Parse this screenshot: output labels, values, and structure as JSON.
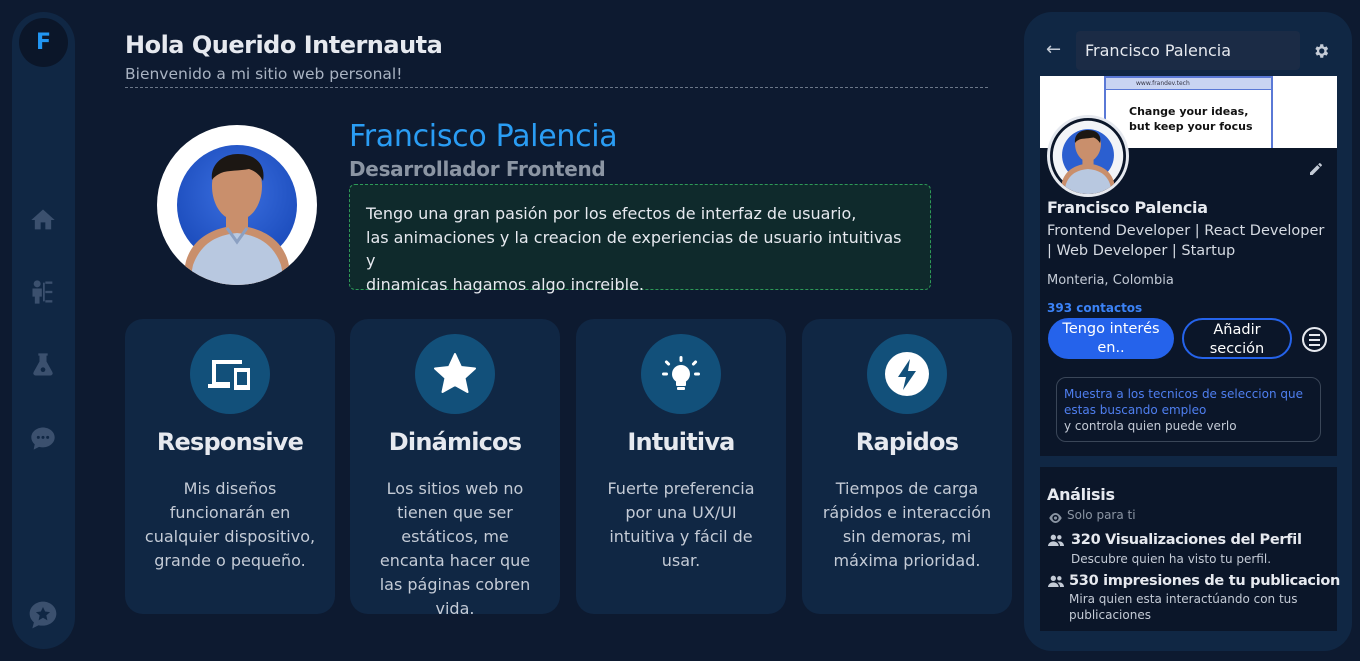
{
  "app": {
    "logo_letter": "F"
  },
  "nav": {
    "items": [
      {
        "icon": "home-icon"
      },
      {
        "icon": "skills-tree-icon"
      },
      {
        "icon": "lab-flask-icon"
      },
      {
        "icon": "chat-icon"
      },
      {
        "icon": "star-badge-icon"
      }
    ]
  },
  "header": {
    "title": "Hola Querido Internauta",
    "subtitle": "Bienvenido a mi sitio web personal!"
  },
  "profile": {
    "name": "Francisco Palencia",
    "role": "Desarrollador Frontend",
    "bio_lines": [
      "Tengo una gran pasión por los efectos de interfaz de usuario,",
      "las animaciones y la creacion de experiencias de usuario intuitivas y",
      "dinamicas hagamos algo increible."
    ]
  },
  "cards": [
    {
      "icon": "devices-icon",
      "title": "Responsive",
      "desc": "Mis diseños funcionarán en cualquier dispositivo, grande o pequeño."
    },
    {
      "icon": "star-icon",
      "title": "Dinámicos",
      "desc": "Los sitios web no tienen que ser estáticos, me encanta hacer que las páginas cobren vida."
    },
    {
      "icon": "lightbulb-icon",
      "title": "Intuitiva",
      "desc": "Fuerte preferencia por una UX/UI intuitiva y fácil de usar."
    },
    {
      "icon": "lightning-icon",
      "title": "Rapidos",
      "desc": "Tiempos de carga rápidos e interacción sin demoras, mi máxima prioridad."
    }
  ],
  "side_panel": {
    "search_value": "Francisco Palencia",
    "banner": {
      "url": "www.frandev.tech",
      "line1": "Change your ideas,",
      "line2": "but keep your focus"
    },
    "name": "Francisco Palencia",
    "headline": "Frontend Developer | React Developer | Web Developer | Startup",
    "location": "Monteria, Colombia",
    "contacts": "393 contactos",
    "btn_interest": "Tengo interés en..",
    "btn_add_section": "Añadir sección",
    "notice_highlight": "Muestra a los tecnicos de seleccion que estas buscando empleo",
    "notice_rest": "y controla quien puede verlo",
    "analysis": {
      "title": "Análisis",
      "private": "Solo para ti",
      "stats": [
        {
          "title": "320 Visualizaciones del Perfil",
          "desc": "Descubre quien ha visto tu perfil."
        },
        {
          "title": "530 impresiones de tu publicacion",
          "desc": "Mira quien esta interactúando con tus publicaciones"
        }
      ]
    }
  },
  "colors": {
    "background": "#0d1a30",
    "card": "#102744",
    "accent": "#2a9df4",
    "button": "#2563eb",
    "icon_circle": "#12507a"
  }
}
